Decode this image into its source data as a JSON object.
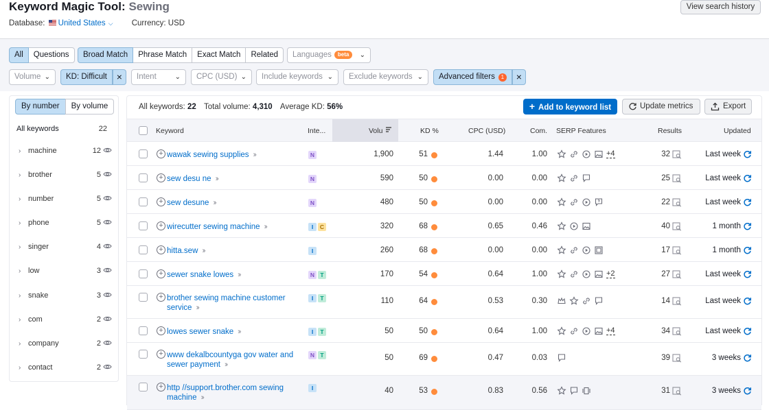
{
  "header": {
    "title": "Keyword Magic Tool:",
    "keyword": "Sewing",
    "database_label": "Database:",
    "database_value": "United States",
    "currency": "Currency: USD",
    "history_button": "View search history"
  },
  "filters": {
    "match_tabs": [
      "All",
      "Questions",
      "Broad Match",
      "Phrase Match",
      "Exact Match",
      "Related"
    ],
    "languages": "Languages",
    "beta": "beta",
    "volume": "Volume",
    "kd_chip": "KD: Difficult",
    "intent": "Intent",
    "cpc": "CPC (USD)",
    "include": "Include keywords",
    "exclude": "Exclude keywords",
    "advanced": "Advanced filters",
    "advanced_count": "1"
  },
  "sidebar": {
    "toggle": [
      "By number",
      "By volume"
    ],
    "all_label": "All keywords",
    "all_count": "22",
    "items": [
      {
        "label": "machine",
        "count": "12"
      },
      {
        "label": "brother",
        "count": "5"
      },
      {
        "label": "number",
        "count": "5"
      },
      {
        "label": "phone",
        "count": "5"
      },
      {
        "label": "singer",
        "count": "4"
      },
      {
        "label": "low",
        "count": "3"
      },
      {
        "label": "snake",
        "count": "3"
      },
      {
        "label": "com",
        "count": "2"
      },
      {
        "label": "company",
        "count": "2"
      },
      {
        "label": "contact",
        "count": "2"
      }
    ]
  },
  "summary": {
    "all_label": "All keywords:",
    "all_value": "22",
    "vol_label": "Total volume:",
    "vol_value": "4,310",
    "kd_label": "Average KD:",
    "kd_value": "56%"
  },
  "actions": {
    "add": "Add to keyword list",
    "update": "Update metrics",
    "export": "Export"
  },
  "table": {
    "headers": {
      "keyword": "Keyword",
      "intent": "Inte...",
      "volume": "Volu",
      "kd": "KD %",
      "cpc": "CPC (USD)",
      "com": "Com.",
      "serp": "SERP Features",
      "results": "Results",
      "updated": "Updated"
    },
    "rows": [
      {
        "keyword": "wawak sewing supplies",
        "intent": [
          "N"
        ],
        "volume": "1,900",
        "kd": "51",
        "cpc": "1.44",
        "com": "1.00",
        "serp": [
          "star-icon",
          "link-icon",
          "video-icon",
          "image-icon"
        ],
        "serp_more": "+4",
        "results": "32",
        "updated": "Last week",
        "refresh": true
      },
      {
        "keyword": "sew desu ne",
        "intent": [
          "N"
        ],
        "volume": "590",
        "kd": "50",
        "cpc": "0.00",
        "com": "0.00",
        "serp": [
          "star-icon",
          "link-icon",
          "review-icon"
        ],
        "serp_more": "",
        "results": "25",
        "updated": "Last week",
        "refresh": true
      },
      {
        "keyword": "sew desune",
        "intent": [
          "N"
        ],
        "volume": "480",
        "kd": "50",
        "cpc": "0.00",
        "com": "0.00",
        "serp": [
          "star-icon",
          "link-icon",
          "video-icon",
          "faq-icon"
        ],
        "serp_more": "",
        "results": "22",
        "updated": "Last week",
        "refresh": true
      },
      {
        "keyword": "wirecutter sewing machine",
        "intent": [
          "I",
          "C"
        ],
        "volume": "320",
        "kd": "68",
        "cpc": "0.65",
        "com": "0.46",
        "serp": [
          "star-icon",
          "video-icon",
          "image-icon"
        ],
        "serp_more": "",
        "results": "40",
        "updated": "1 month",
        "refresh": true
      },
      {
        "keyword": "hitta.sew",
        "intent": [
          "I"
        ],
        "volume": "260",
        "kd": "68",
        "cpc": "0.00",
        "com": "0.00",
        "serp": [
          "star-icon",
          "link-icon",
          "video-icon",
          "gallery-icon"
        ],
        "serp_more": "",
        "results": "17",
        "updated": "1 month",
        "refresh": true
      },
      {
        "keyword": "sewer snake lowes",
        "intent": [
          "N",
          "T"
        ],
        "volume": "170",
        "kd": "54",
        "cpc": "0.64",
        "com": "1.00",
        "serp": [
          "star-icon",
          "link-icon",
          "video-icon",
          "image-icon"
        ],
        "serp_more": "+2",
        "results": "27",
        "updated": "Last week",
        "refresh": true
      },
      {
        "keyword": "brother sewing machine customer service",
        "intent": [
          "I",
          "T"
        ],
        "volume": "110",
        "kd": "64",
        "cpc": "0.53",
        "com": "0.30",
        "serp": [
          "crown-icon",
          "star-icon",
          "link-icon",
          "review-icon"
        ],
        "serp_more": "",
        "results": "14",
        "updated": "Last week",
        "refresh": true
      },
      {
        "keyword": "lowes sewer snake",
        "intent": [
          "I",
          "T"
        ],
        "volume": "50",
        "kd": "50",
        "cpc": "0.64",
        "com": "1.00",
        "serp": [
          "star-icon",
          "link-icon",
          "video-icon",
          "image-icon"
        ],
        "serp_more": "+4",
        "results": "34",
        "updated": "Last week",
        "refresh": true
      },
      {
        "keyword": "www dekalbcountyga gov water and sewer payment",
        "intent": [
          "N",
          "T"
        ],
        "volume": "50",
        "kd": "69",
        "cpc": "0.47",
        "com": "0.03",
        "serp": [
          "review-icon"
        ],
        "serp_more": "",
        "results": "39",
        "updated": "3 weeks",
        "refresh": true
      },
      {
        "keyword": "http //support.brother.com sewing machine",
        "intent": [
          "I"
        ],
        "volume": "40",
        "kd": "53",
        "cpc": "0.83",
        "com": "0.56",
        "serp": [
          "star-icon",
          "review-icon",
          "carousel-icon"
        ],
        "serp_more": "",
        "results": "31",
        "updated": "3 weeks",
        "refresh": true
      }
    ]
  },
  "colors": {
    "accent": "#006dca",
    "kd_dot": "#ff8c3c",
    "active_tab": "#c2def5"
  }
}
